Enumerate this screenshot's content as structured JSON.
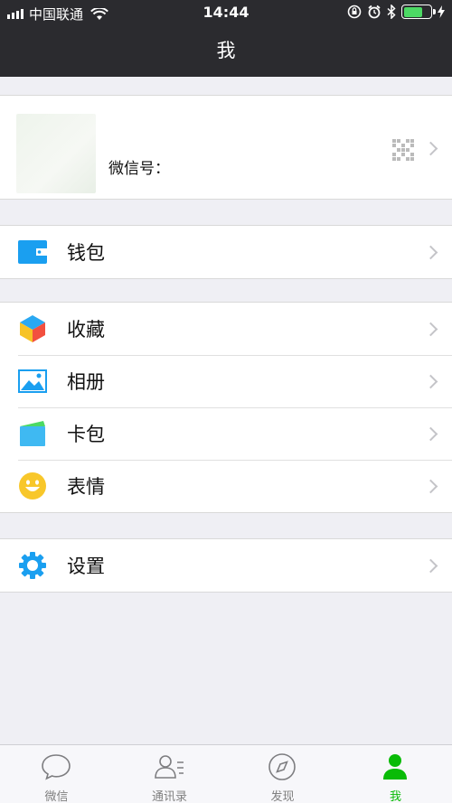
{
  "status_bar": {
    "carrier": "中国联通",
    "time": "14:44",
    "battery_level": 0.7
  },
  "header": {
    "title": "我"
  },
  "profile": {
    "wechat_id_label": "微信号：",
    "wechat_id_value": ""
  },
  "menu": {
    "wallet": "钱包",
    "favorites": "收藏",
    "album": "相册",
    "cards": "卡包",
    "stickers": "表情",
    "settings": "设置"
  },
  "tabs": [
    {
      "label": "微信",
      "icon": "chat-bubble-icon"
    },
    {
      "label": "通讯录",
      "icon": "contacts-icon"
    },
    {
      "label": "发现",
      "icon": "compass-icon"
    },
    {
      "label": "我",
      "icon": "me-person-icon",
      "active": true
    }
  ],
  "colors": {
    "accent_green": "#09bb07",
    "header_bg": "#2b2b2f",
    "page_bg": "#efeff4"
  }
}
